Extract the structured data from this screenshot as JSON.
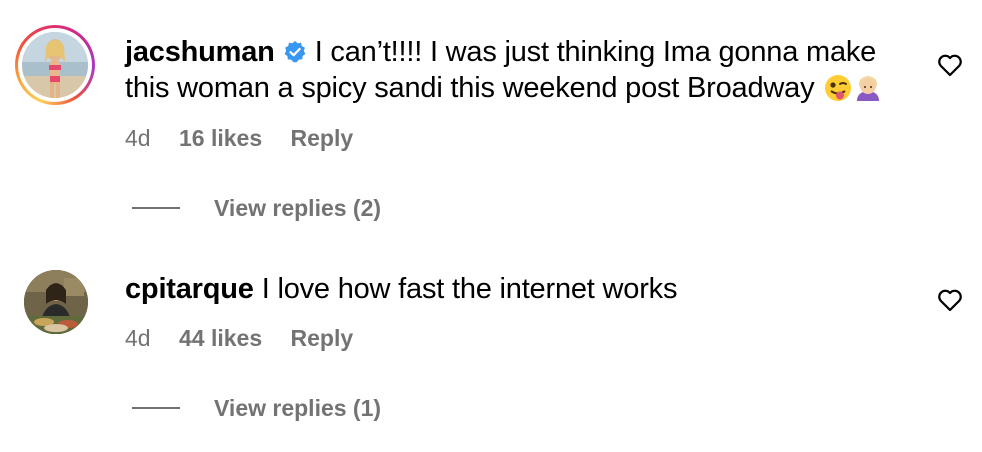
{
  "comments": [
    {
      "username": "jacshuman",
      "verified": true,
      "text_line1": "I can’t!!!! I was just thinking Ima gonna make",
      "text_line2": "this woman a spicy sandi this weekend post Broadway",
      "emojis": [
        "winking-tongue-emoji",
        "woman-facepalm-emoji"
      ],
      "time": "4d",
      "likes": "16 likes",
      "reply_label": "Reply",
      "view_replies": "View replies (2)"
    },
    {
      "username": "cpitarque",
      "verified": false,
      "text_line1": "I love how fast the internet works",
      "time": "4d",
      "likes": "44 likes",
      "reply_label": "Reply",
      "view_replies": "View replies (1)"
    }
  ],
  "colors": {
    "text": "#000000",
    "secondary": "#737373",
    "verified_blue": "#3897f0"
  },
  "icons": [
    "verified-badge-icon",
    "heart-icon"
  ]
}
